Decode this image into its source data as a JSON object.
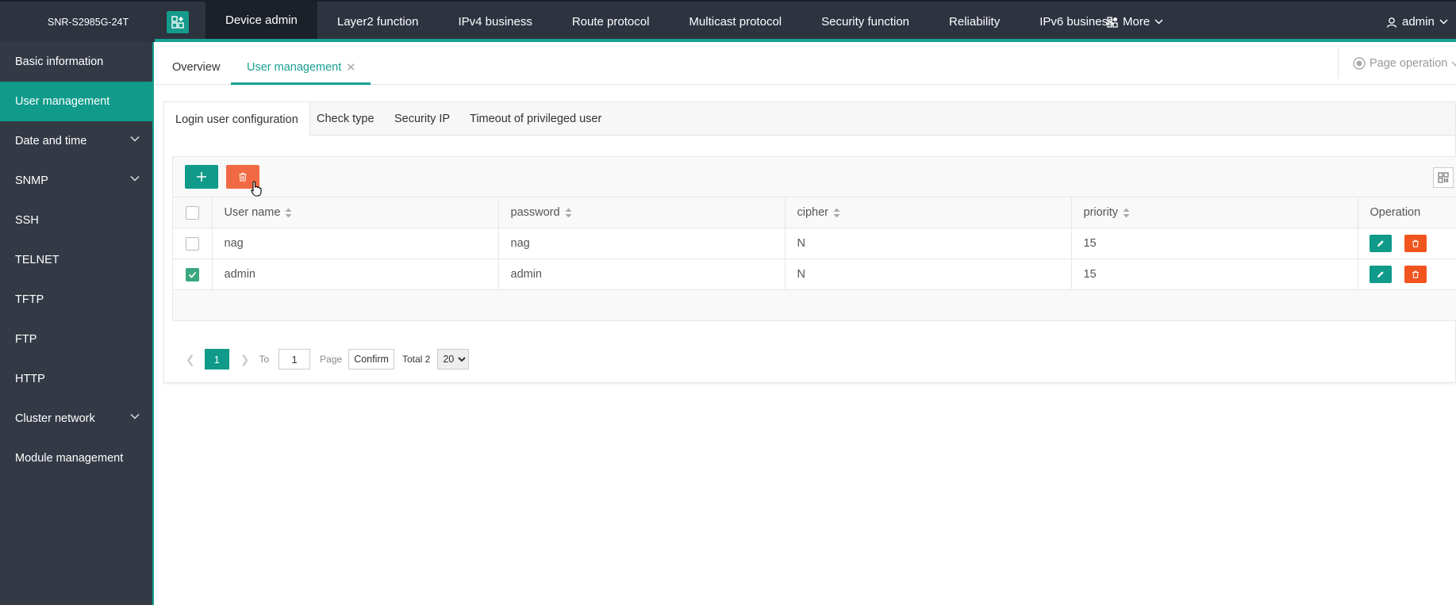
{
  "topbar": {
    "device_name": "SNR-S2985G-24T",
    "nav": [
      "Device admin",
      "Layer2 function",
      "IPv4 business",
      "Route protocol",
      "Multicast protocol",
      "Security function",
      "Reliability",
      "IPv6 business"
    ],
    "more_label": "More",
    "user_label": "admin"
  },
  "sidebar": {
    "items": [
      {
        "label": "Basic information",
        "expandable": false,
        "active": false
      },
      {
        "label": "User management",
        "expandable": false,
        "active": true
      },
      {
        "label": "Date and time",
        "expandable": true,
        "active": false
      },
      {
        "label": "SNMP",
        "expandable": true,
        "active": false
      },
      {
        "label": "SSH",
        "expandable": false,
        "active": false
      },
      {
        "label": "TELNET",
        "expandable": false,
        "active": false
      },
      {
        "label": "TFTP",
        "expandable": false,
        "active": false
      },
      {
        "label": "FTP",
        "expandable": false,
        "active": false
      },
      {
        "label": "HTTP",
        "expandable": false,
        "active": false
      },
      {
        "label": "Cluster network",
        "expandable": true,
        "active": false
      },
      {
        "label": "Module management",
        "expandable": false,
        "active": false
      }
    ]
  },
  "page_tabs": {
    "overview": "Overview",
    "user_management": "User management",
    "page_operation": "Page operation"
  },
  "sub_tabs": [
    "Login user configuration",
    "Check type",
    "Security IP",
    "Timeout of privileged user"
  ],
  "table": {
    "columns": [
      "User name",
      "password",
      "cipher",
      "priority",
      "Operation"
    ],
    "rows": [
      {
        "user": "nag",
        "password": "nag",
        "cipher": "N",
        "priority": "15",
        "checked": false
      },
      {
        "user": "admin",
        "password": "admin",
        "cipher": "N",
        "priority": "15",
        "checked": true
      }
    ]
  },
  "pager": {
    "current_page": "1",
    "to_label": "To",
    "to_value": "1",
    "page_label": "Page",
    "confirm_label": "Confirm",
    "total_label": "Total 2",
    "page_size": "20"
  },
  "colors": {
    "accent": "#18a093",
    "topbar_bg": "#2d333f",
    "sidebar_bg": "#343a45",
    "danger": "#f26a43"
  }
}
